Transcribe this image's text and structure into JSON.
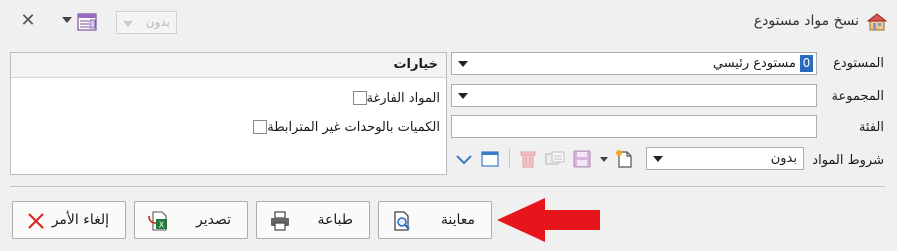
{
  "window": {
    "title": "نسخ مواد مستودع",
    "language_value": "بدون",
    "close_label": "✕"
  },
  "options": {
    "header": "خيارات",
    "checkboxes": [
      {
        "label": "المواد الفارغة",
        "checked": false
      },
      {
        "label": "الكميات بالوحدات غير المترابطة",
        "checked": false
      }
    ]
  },
  "form": {
    "warehouse": {
      "label": "المستودع",
      "number": "0",
      "value": "مستودع رئيسي"
    },
    "group": {
      "label": "المجموعة",
      "value": ""
    },
    "category": {
      "label": "الفئة",
      "value": ""
    },
    "conditions": {
      "label": "شروط المواد",
      "value": "بدون"
    }
  },
  "buttons": {
    "preview": "معاينة",
    "print": "طباعة",
    "export": "تصدير",
    "cancel": "إلغاء الأمر"
  },
  "colors": {
    "accent_blue": "#2a6bbf",
    "arrow_red": "#e8141b",
    "excel_green": "#1e7a3a",
    "cancel_red": "#d9241c"
  }
}
